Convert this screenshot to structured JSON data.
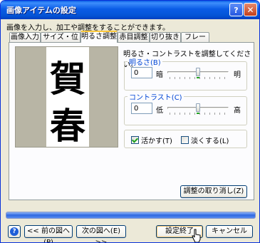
{
  "window": {
    "title": "画像アイテムの設定",
    "help_glyph": "?",
    "close_glyph": "✕"
  },
  "intro": "画像を入力し、加工や調整をすることができます。",
  "tabs": [
    "画像入力",
    "サイズ・位置",
    "明るさ調整",
    "赤目調整",
    "切り抜き",
    "フレーム"
  ],
  "active_tab": 2,
  "preview": {
    "calligraphy_top": "賀",
    "calligraphy_bottom": "春"
  },
  "hint": "明るさ・コントラストを調整してください。",
  "brightness": {
    "label": "明るさ(B)",
    "value": "0",
    "min_label": "暗",
    "max_label": "明",
    "level_percent": 50
  },
  "contrast": {
    "label": "コントラスト(C)",
    "value": "0",
    "min_label": "低",
    "max_label": "高",
    "level_percent": 50
  },
  "options": [
    {
      "label": "活かす(T)",
      "checked": true
    },
    {
      "label": "淡くする(L)",
      "checked": false
    }
  ],
  "reset_button": "調整の取り消し(Z)",
  "nav": {
    "prev": "<< 前の図へ(P)",
    "next": "次の図へ(E) >>"
  },
  "ok_button": "設定終了",
  "cancel_button": "キャンセル",
  "progress_percent": 100
}
